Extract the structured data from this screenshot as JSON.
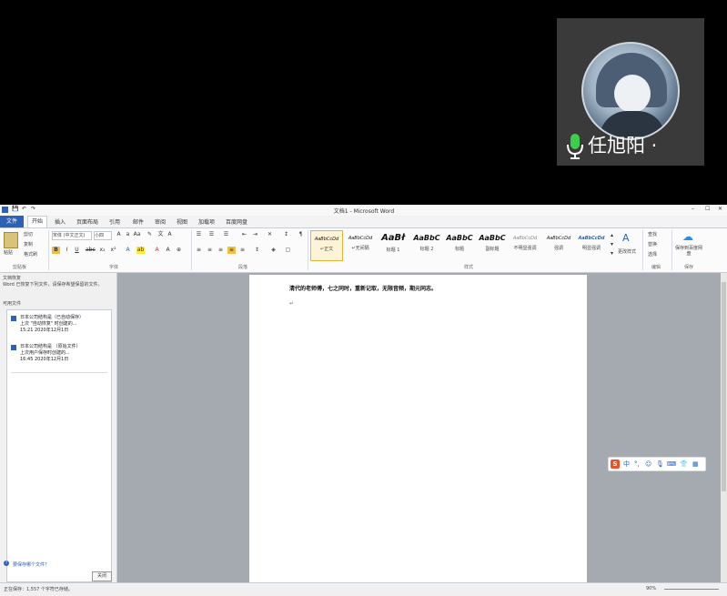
{
  "meeting": {
    "speaker_name": "任旭阳 ·"
  },
  "window": {
    "title": "文档1 - Microsoft Word"
  },
  "ribbon": {
    "tabs": [
      "文件",
      "开始",
      "插入",
      "页面布局",
      "引用",
      "邮件",
      "审阅",
      "视图",
      "加载项",
      "百度网盘"
    ],
    "clipboard": {
      "paste": "粘贴",
      "cut": "剪切",
      "copy": "复制",
      "format_painter": "格式刷",
      "label": "剪贴板"
    },
    "font": {
      "name": "宋体 (中文正文)",
      "size": "小四",
      "label": "字体"
    },
    "paragraph": {
      "label": "段落"
    },
    "styles": {
      "label": "样式",
      "items": [
        {
          "sample": "AaBbCcDd",
          "name": "↵正文"
        },
        {
          "sample": "AaBbCcDd",
          "name": "↵无间隔"
        },
        {
          "sample": "AaBł",
          "name": "标题 1"
        },
        {
          "sample": "AaBbC",
          "name": "标题 2"
        },
        {
          "sample": "AaBbC",
          "name": "标题"
        },
        {
          "sample": "AaBbC",
          "name": "副标题"
        },
        {
          "sample": "AaBbCcDd",
          "name": "不明显强调"
        },
        {
          "sample": "AaBbCcDd",
          "name": "强调"
        },
        {
          "sample": "AaBbCcDd",
          "name": "明显强调"
        }
      ],
      "change_styles": "更改样式"
    },
    "editing": {
      "find": "查找",
      "replace": "替换",
      "select": "选择",
      "label": "编辑"
    },
    "baidu": {
      "save": "保存到百度网盘",
      "label": "保存"
    }
  },
  "nav_pane": {
    "title": "文档恢复",
    "message": "Word 已恢复下列文件，请保存希望保留的文件。",
    "available_label": "可用文件",
    "items": [
      {
        "line1": "日本公司结构是（已自动保存）",
        "line2": "上次 \"自动恢复\" 时创建的...",
        "line3": "15:21  2020年12月1日"
      },
      {
        "line1": "日本公司结构是 （原始文件）",
        "line2": "上次用户保存时创建的...",
        "line3": "16:45  2020年12月1日"
      }
    ],
    "which_file_link": "要保存哪个文件？",
    "close_button": "关闭"
  },
  "document": {
    "text_line": "清代的老师傅，七之同时，重新记取，无限音频，期元同志。",
    "paragraph_mark": "↵"
  },
  "status_bar": {
    "text": "正在保存：1,557 个字符已存储。",
    "zoom": "90%"
  },
  "ime": {
    "logo": "S",
    "items": [
      "中",
      "°,",
      "☺",
      "🎙",
      "⌨",
      "👕",
      "▦"
    ]
  }
}
